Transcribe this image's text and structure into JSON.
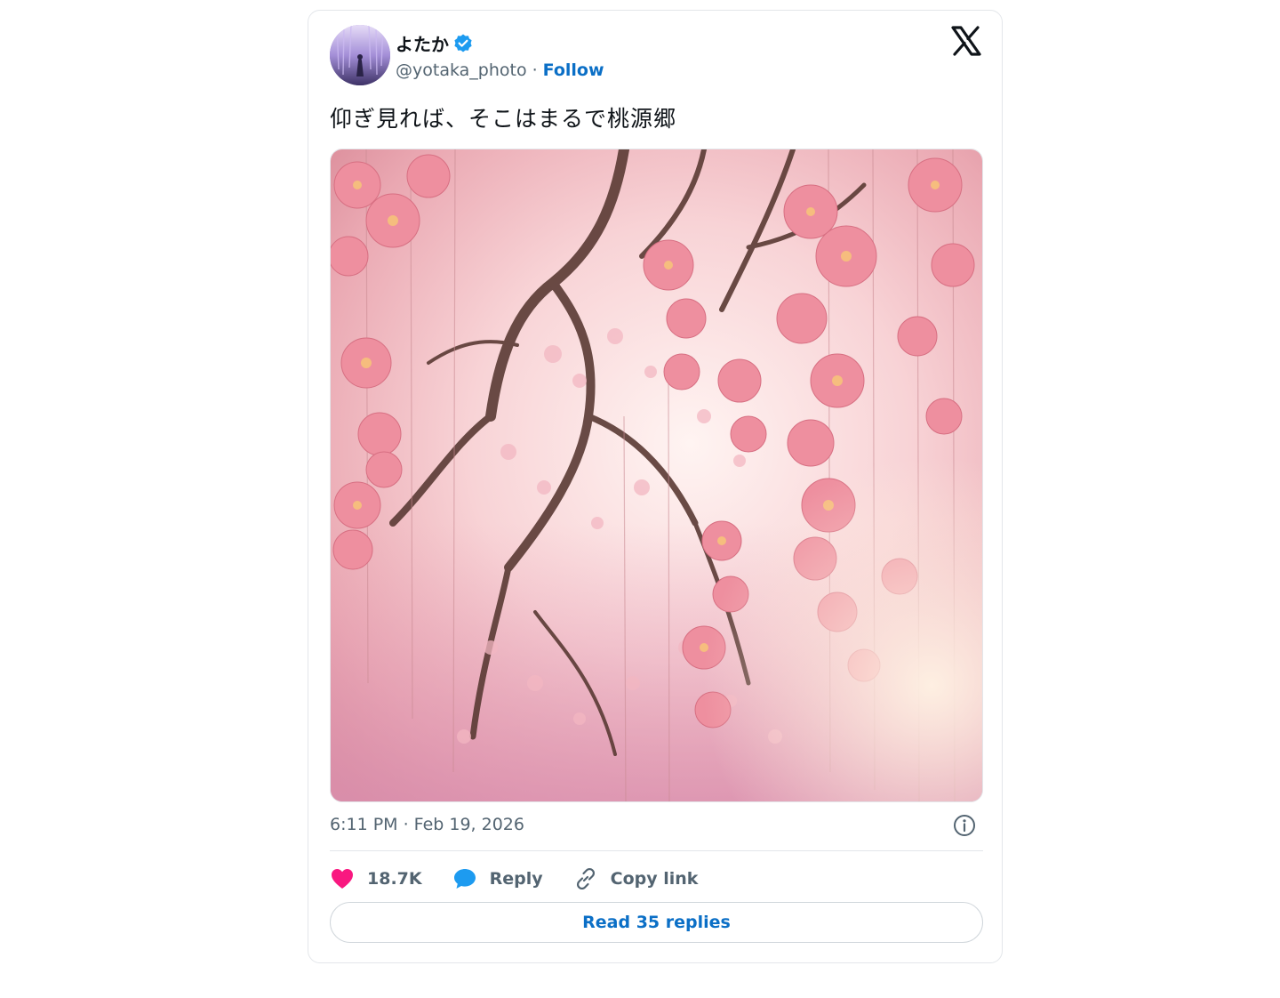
{
  "author": {
    "display_name": "よたか",
    "handle": "@yotaka_photo",
    "separator": "·",
    "follow_label": "Follow",
    "verified": true
  },
  "tweet": {
    "text": "仰ぎ見れば、そこはまるで桃源郷",
    "timestamp": "6:11 PM · Feb 19, 2026"
  },
  "actions": {
    "likes_count": "18.7K",
    "reply_label": "Reply",
    "copy_link_label": "Copy link"
  },
  "footer": {
    "read_replies_label": "Read 35 replies"
  },
  "colors": {
    "accent": "#0b6fc6",
    "like": "#f91880",
    "reply": "#1d9bf0",
    "verified": "#1d9bf0"
  },
  "icons": {
    "logo": "x-logo-icon",
    "verified": "verified-badge-icon",
    "info": "info-icon",
    "like": "heart-icon",
    "reply": "speech-bubble-icon",
    "copy": "link-icon"
  }
}
